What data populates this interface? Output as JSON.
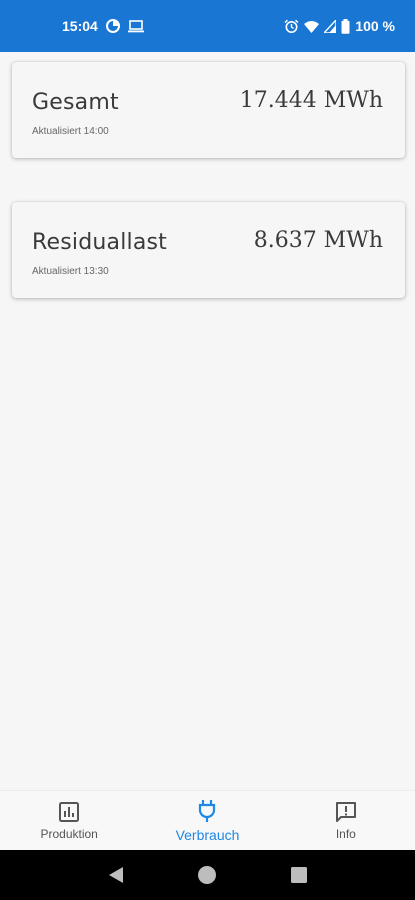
{
  "status_bar": {
    "time": "15:04",
    "battery": "100 %",
    "icons": [
      "data-saver-icon",
      "laptop-icon",
      "alarm-icon",
      "wifi-icon",
      "signal-icon",
      "battery-icon"
    ]
  },
  "cards": [
    {
      "title": "Gesamt",
      "value": "17.444 MWh",
      "updated": "Aktualisiert  14:00"
    },
    {
      "title": "Residuallast",
      "value": "8.637 MWh",
      "updated": "Aktualisiert  13:30"
    }
  ],
  "bottom_nav": {
    "items": [
      {
        "label": "Produktion",
        "icon": "bar-chart-icon",
        "active": false
      },
      {
        "label": "Verbrauch",
        "icon": "plug-icon",
        "active": true
      },
      {
        "label": "Info",
        "icon": "feedback-icon",
        "active": false
      }
    ]
  },
  "colors": {
    "status_bar": "#1976d2",
    "accent": "#1e88e5",
    "background": "#f6f6f6"
  }
}
